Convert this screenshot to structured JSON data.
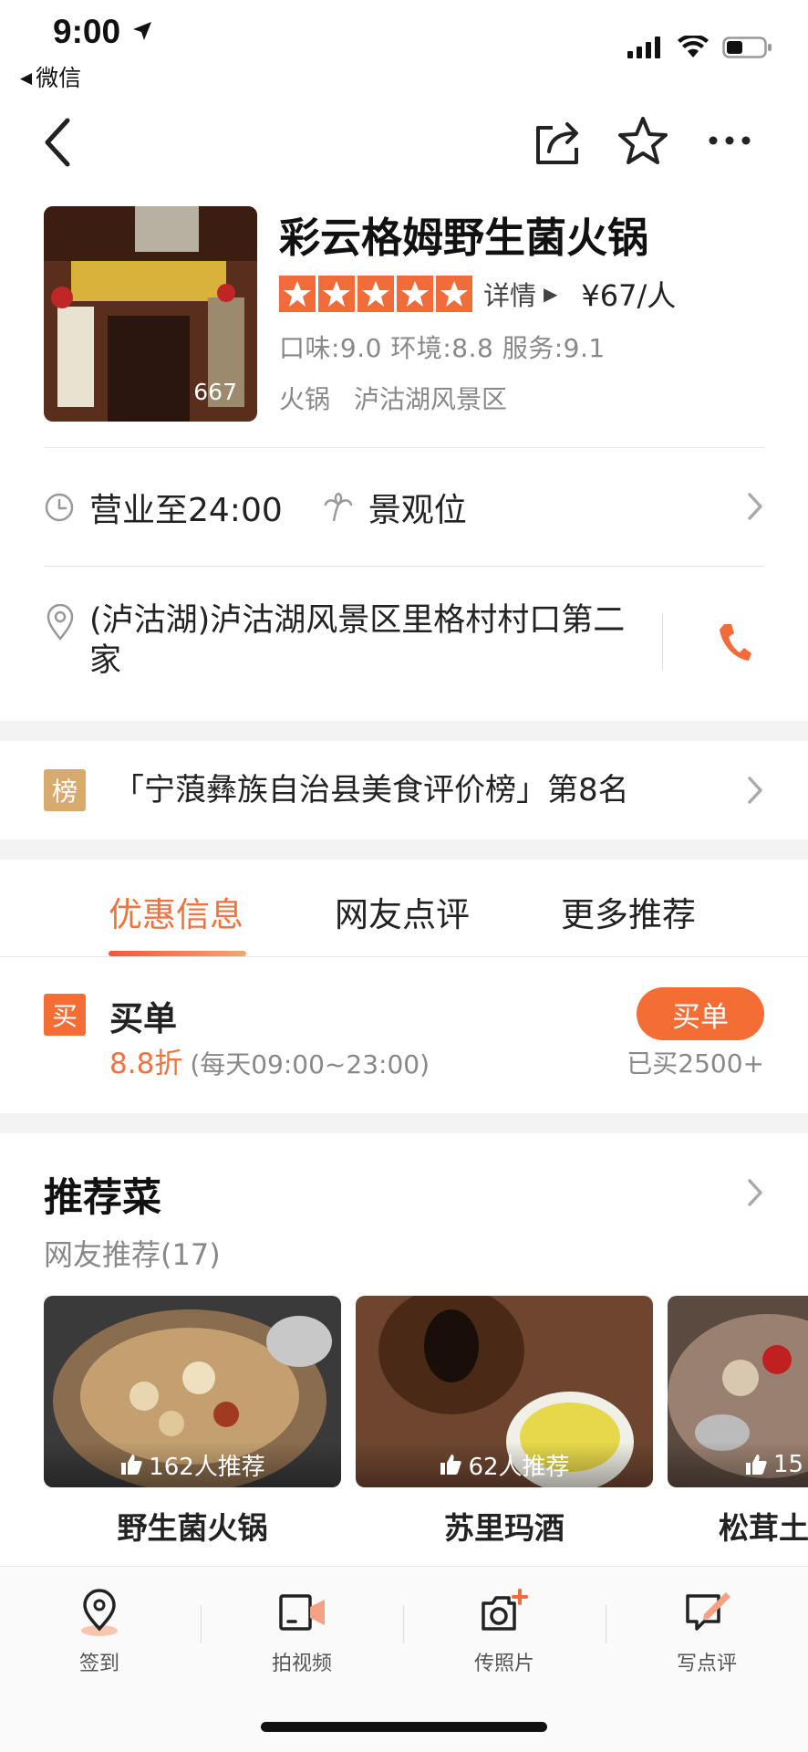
{
  "status_bar": {
    "time": "9:00",
    "back_app": "微信"
  },
  "shop": {
    "name": "彩云格姆野生菌火锅",
    "photo_count": "667",
    "rating_detail": "详情",
    "price": "¥67/人",
    "scores": "口味:9.0 环境:8.8 服务:9.1",
    "category": "火锅",
    "area": "泸沽湖风景区",
    "hours": "营业至24:00",
    "feature": "景观位",
    "address": "(泸沽湖)泸沽湖风景区里格村村口第二家",
    "stars": 5
  },
  "ranking": {
    "badge": "榜",
    "text": "「宁蒗彝族自治县美食评价榜」第8名"
  },
  "tabs": [
    "优惠信息",
    "网友点评",
    "更多推荐"
  ],
  "deal": {
    "badge": "买",
    "title": "买单",
    "discount": "8.8折",
    "hours": "(每天09:00~23:00)",
    "button": "买单",
    "sold": "已买2500+"
  },
  "recommended": {
    "title": "推荐菜",
    "subtitle": "网友推荐(17)",
    "dishes": [
      {
        "name": "野生菌火锅",
        "votes": "162人推荐"
      },
      {
        "name": "苏里玛酒",
        "votes": "62人推荐"
      },
      {
        "name": "松茸土",
        "votes": "15"
      }
    ]
  },
  "bottom_bar": [
    "签到",
    "拍视频",
    "传照片",
    "写点评"
  ],
  "colors": {
    "accent": "#f36d35",
    "rank_badge": "#d7aa6e"
  }
}
